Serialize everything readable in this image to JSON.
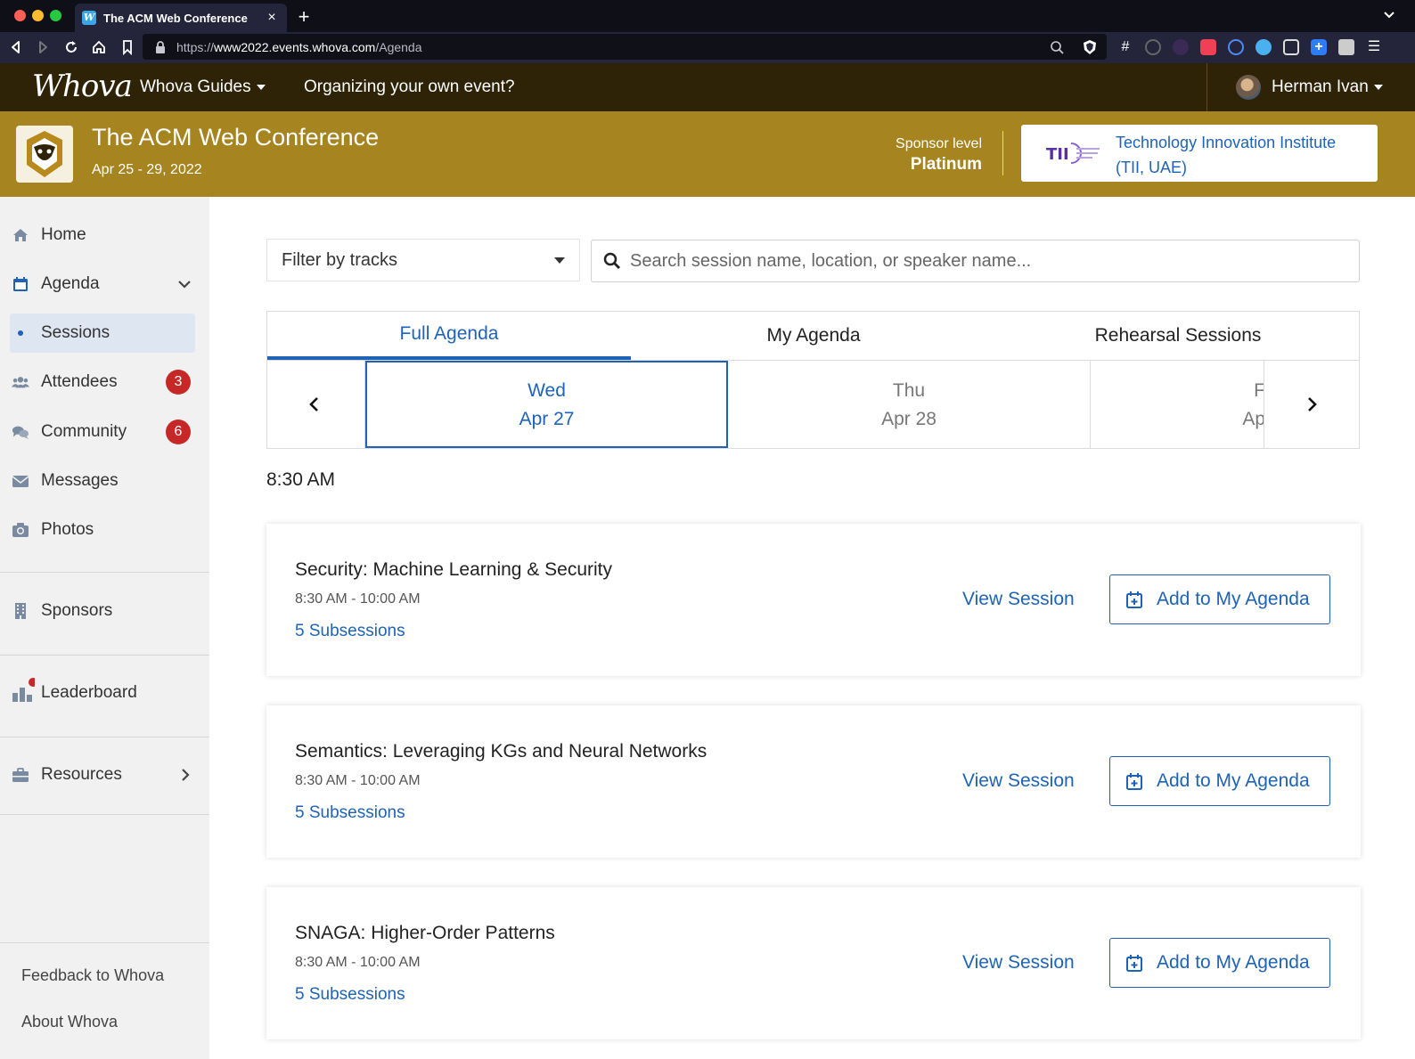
{
  "browser": {
    "tab_title": "The ACM Web Conference",
    "tab_favicon": "W",
    "url_prefix": "https://",
    "url_host": "www2022.events.whova.com",
    "url_path": "/Agenda"
  },
  "topbar": {
    "logo": "Whova",
    "guides": "Whova Guides",
    "organizing": "Organizing your own event?",
    "user_name": "Herman Ivan"
  },
  "banner": {
    "title": "The ACM Web Conference",
    "dates": "Apr 25 - 29, 2022",
    "sponsor_label": "Sponsor level",
    "sponsor_level": "Platinum",
    "sponsor_name": "Technology Innovation Institute (TII, UAE)"
  },
  "sidebar": {
    "items": [
      {
        "label": "Home",
        "icon": "home-icon"
      },
      {
        "label": "Agenda",
        "icon": "calendar-icon"
      },
      {
        "label": "Sessions"
      },
      {
        "label": "Attendees",
        "icon": "users-icon",
        "badge": "3"
      },
      {
        "label": "Community",
        "icon": "comments-icon",
        "badge": "6"
      },
      {
        "label": "Messages",
        "icon": "envelope-icon"
      },
      {
        "label": "Photos",
        "icon": "camera-icon"
      },
      {
        "label": "Sponsors",
        "icon": "building-icon"
      },
      {
        "label": "Leaderboard",
        "icon": "leaderboard-icon"
      },
      {
        "label": "Resources",
        "icon": "briefcase-icon"
      }
    ],
    "footer": [
      "Feedback to Whova",
      "About Whova"
    ]
  },
  "main": {
    "filter_label": "Filter by tracks",
    "search_placeholder": "Search session name, location, or speaker name...",
    "tabs": [
      "Full Agenda",
      "My Agenda",
      "Rehearsal Sessions"
    ],
    "dates": [
      {
        "day": "Wed",
        "date": "Apr 27"
      },
      {
        "day": "Thu",
        "date": "Apr 28"
      },
      {
        "day": "F",
        "date": "Ap"
      }
    ],
    "time_heading": "8:30 AM",
    "view_label": "View Session",
    "add_label": "Add to My Agenda",
    "sessions": [
      {
        "title": "Security: Machine Learning & Security",
        "time": "8:30 AM - 10:00 AM",
        "subsessions": "5 Subsessions"
      },
      {
        "title": "Semantics: Leveraging KGs and Neural Networks",
        "time": "8:30 AM - 10:00 AM",
        "subsessions": "5 Subsessions"
      },
      {
        "title": "SNAGA: Higher-Order Patterns",
        "time": "8:30 AM - 10:00 AM",
        "subsessions": "5 Subsessions"
      }
    ]
  },
  "colors": {
    "topbar": "#2f2307",
    "banner": "#a68420",
    "accent": "#1e63b6",
    "badge": "#c62828"
  }
}
